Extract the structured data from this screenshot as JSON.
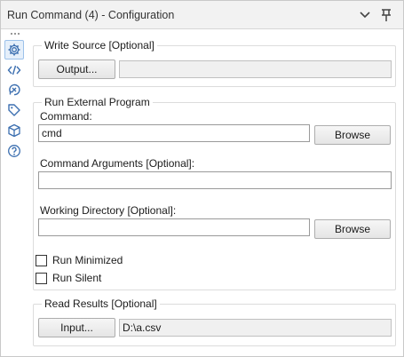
{
  "window": {
    "title": "Run Command (4) - Configuration",
    "icons": [
      "chevron-down-icon",
      "pin-icon"
    ]
  },
  "rail": {
    "items": [
      {
        "name": "gear-icon",
        "active": true
      },
      {
        "name": "code-icon",
        "active": false
      },
      {
        "name": "connection-icon",
        "active": false
      },
      {
        "name": "tag-icon",
        "active": false
      },
      {
        "name": "cube-icon",
        "active": false
      },
      {
        "name": "help-icon",
        "active": false
      }
    ]
  },
  "write_source": {
    "legend": "Write Source [Optional]",
    "button_label": "Output...",
    "value": ""
  },
  "run_external": {
    "legend": "Run External Program",
    "command_label": "Command:",
    "command_value": "cmd",
    "browse_label": "Browse",
    "args_label": "Command Arguments [Optional]:",
    "args_value": "",
    "workdir_label": "Working Directory [Optional]:",
    "workdir_value": "",
    "workdir_browse_label": "Browse",
    "run_minimized_label": "Run Minimized",
    "run_minimized_checked": false,
    "run_silent_label": "Run Silent",
    "run_silent_checked": false
  },
  "read_results": {
    "legend": "Read Results [Optional]",
    "button_label": "Input...",
    "value": "D:\\a.csv"
  }
}
